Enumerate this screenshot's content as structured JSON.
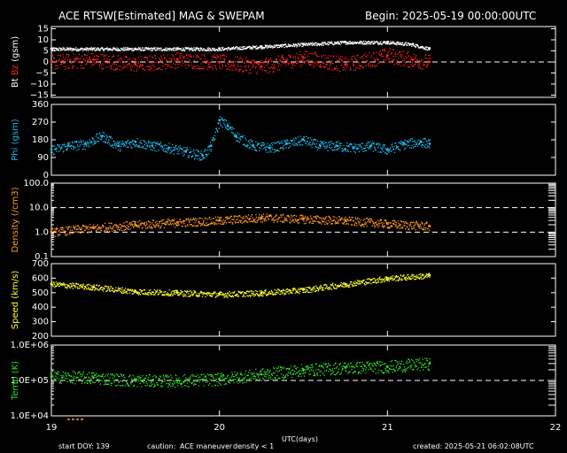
{
  "header": {
    "title": "ACE RTSW[Estimated] MAG & SWEPAM",
    "begin": "Begin: 2025-05-19 00:00:00UTC"
  },
  "footer": {
    "start_doy": "start DOY: 139",
    "caution": "caution:",
    "maneuver": "ACE maneuver",
    "density_note": "density < 1",
    "created": "created: 2025-05-21 06:02:08UTC",
    "xlabel": "UTC(days)"
  },
  "colors": {
    "bt": "#ffffff",
    "bz": "#ff2020",
    "phi": "#20b8e8",
    "density": "#ff9a28",
    "speed": "#ffff30",
    "temp": "#30e030",
    "caution_maneuver": "#ffff30",
    "caution_density": "#ff9a28"
  },
  "chart_data": [
    {
      "type": "scatter",
      "title": "Bt / Bz",
      "ylabel_parts": [
        "Bt",
        "Bz",
        "(gsm)"
      ],
      "ylim": [
        -16,
        16
      ],
      "yticks": [
        "15",
        "10",
        "5",
        "0",
        "−5",
        "−10",
        "−15"
      ],
      "ytick_values": [
        15,
        10,
        5,
        0,
        -5,
        -10,
        -15
      ],
      "reference_line": 0,
      "x_range_days": [
        19,
        22
      ],
      "series": [
        {
          "name": "Bt",
          "x": [
            19.0,
            19.25,
            19.5,
            19.75,
            20.0,
            20.25,
            20.5,
            20.75,
            21.0,
            21.15,
            21.25
          ],
          "values": [
            6,
            6,
            6,
            6,
            6,
            7,
            8,
            9,
            9,
            8,
            6
          ]
        },
        {
          "name": "Bz",
          "x": [
            19.0,
            19.25,
            19.5,
            19.75,
            20.0,
            20.25,
            20.5,
            20.75,
            21.0,
            21.15,
            21.25
          ],
          "values": [
            0,
            1,
            -1,
            1,
            0,
            -2,
            2,
            -1,
            3,
            1,
            0
          ]
        }
      ]
    },
    {
      "type": "scatter",
      "title": "Phi",
      "ylabel_parts": [
        "Phi (gsm)"
      ],
      "ylim": [
        0,
        360
      ],
      "yticks": [
        "360",
        "270",
        "180",
        "90",
        "0"
      ],
      "ytick_values": [
        360,
        270,
        180,
        90,
        0
      ],
      "x_range_days": [
        19,
        22
      ],
      "series": [
        {
          "name": "Phi",
          "x": [
            19.0,
            19.1,
            19.2,
            19.3,
            19.4,
            19.5,
            19.6,
            19.7,
            19.8,
            19.9,
            19.95,
            20.0,
            20.05,
            20.1,
            20.2,
            20.3,
            20.4,
            20.5,
            20.6,
            20.7,
            20.8,
            20.9,
            21.0,
            21.1,
            21.2,
            21.25
          ],
          "values": [
            130,
            150,
            160,
            200,
            150,
            170,
            150,
            140,
            120,
            100,
            150,
            280,
            250,
            200,
            150,
            140,
            160,
            180,
            150,
            150,
            140,
            150,
            130,
            160,
            170,
            160
          ]
        }
      ]
    },
    {
      "type": "scatter",
      "title": "Density",
      "ylabel_parts": [
        "Density (/cm3)"
      ],
      "ylim": [
        0.1,
        100
      ],
      "log_scale": true,
      "yticks": [
        "100.0",
        "10.0",
        "1.0",
        "0.1"
      ],
      "ytick_values": [
        100,
        10,
        1,
        0.1
      ],
      "reference_lines": [
        10,
        1
      ],
      "x_range_days": [
        19,
        22
      ],
      "series": [
        {
          "name": "Density",
          "x": [
            19.0,
            19.25,
            19.5,
            19.75,
            20.0,
            20.25,
            20.5,
            20.75,
            21.0,
            21.25
          ],
          "values": [
            1.0,
            1.5,
            2.0,
            2.5,
            3.0,
            4.0,
            3.5,
            3.0,
            2.2,
            1.8
          ]
        }
      ]
    },
    {
      "type": "scatter",
      "title": "Speed",
      "ylabel_parts": [
        "Speed (km/s)"
      ],
      "ylim": [
        200,
        700
      ],
      "yticks": [
        "700",
        "600",
        "500",
        "400",
        "300",
        "200"
      ],
      "ytick_values": [
        700,
        600,
        500,
        400,
        300,
        200
      ],
      "x_range_days": [
        19,
        22
      ],
      "series": [
        {
          "name": "Speed",
          "x": [
            19.0,
            19.25,
            19.5,
            19.75,
            20.0,
            20.25,
            20.5,
            20.75,
            21.0,
            21.25
          ],
          "values": [
            560,
            540,
            510,
            500,
            490,
            500,
            520,
            560,
            600,
            620
          ]
        }
      ]
    },
    {
      "type": "scatter",
      "title": "Temp",
      "ylabel_parts": [
        "Temp (K)"
      ],
      "ylim": [
        10000,
        1000000
      ],
      "log_scale": true,
      "yticks": [
        "1.0E+06",
        "1.0E+05",
        "1.0E+04"
      ],
      "ytick_values": [
        1000000,
        100000,
        10000
      ],
      "reference_line": 100000,
      "x_range_days": [
        19,
        22
      ],
      "series": [
        {
          "name": "Temp",
          "x": [
            19.0,
            19.25,
            19.5,
            19.75,
            20.0,
            20.25,
            20.5,
            20.75,
            21.0,
            21.25
          ],
          "values": [
            130000,
            120000,
            100000,
            100000,
            110000,
            150000,
            200000,
            230000,
            250000,
            300000
          ]
        }
      ]
    }
  ],
  "x_axis": {
    "ticks": [
      "19",
      "20",
      "21",
      "22"
    ],
    "tick_values": [
      19,
      20,
      21,
      22
    ],
    "range": [
      19,
      22
    ]
  }
}
